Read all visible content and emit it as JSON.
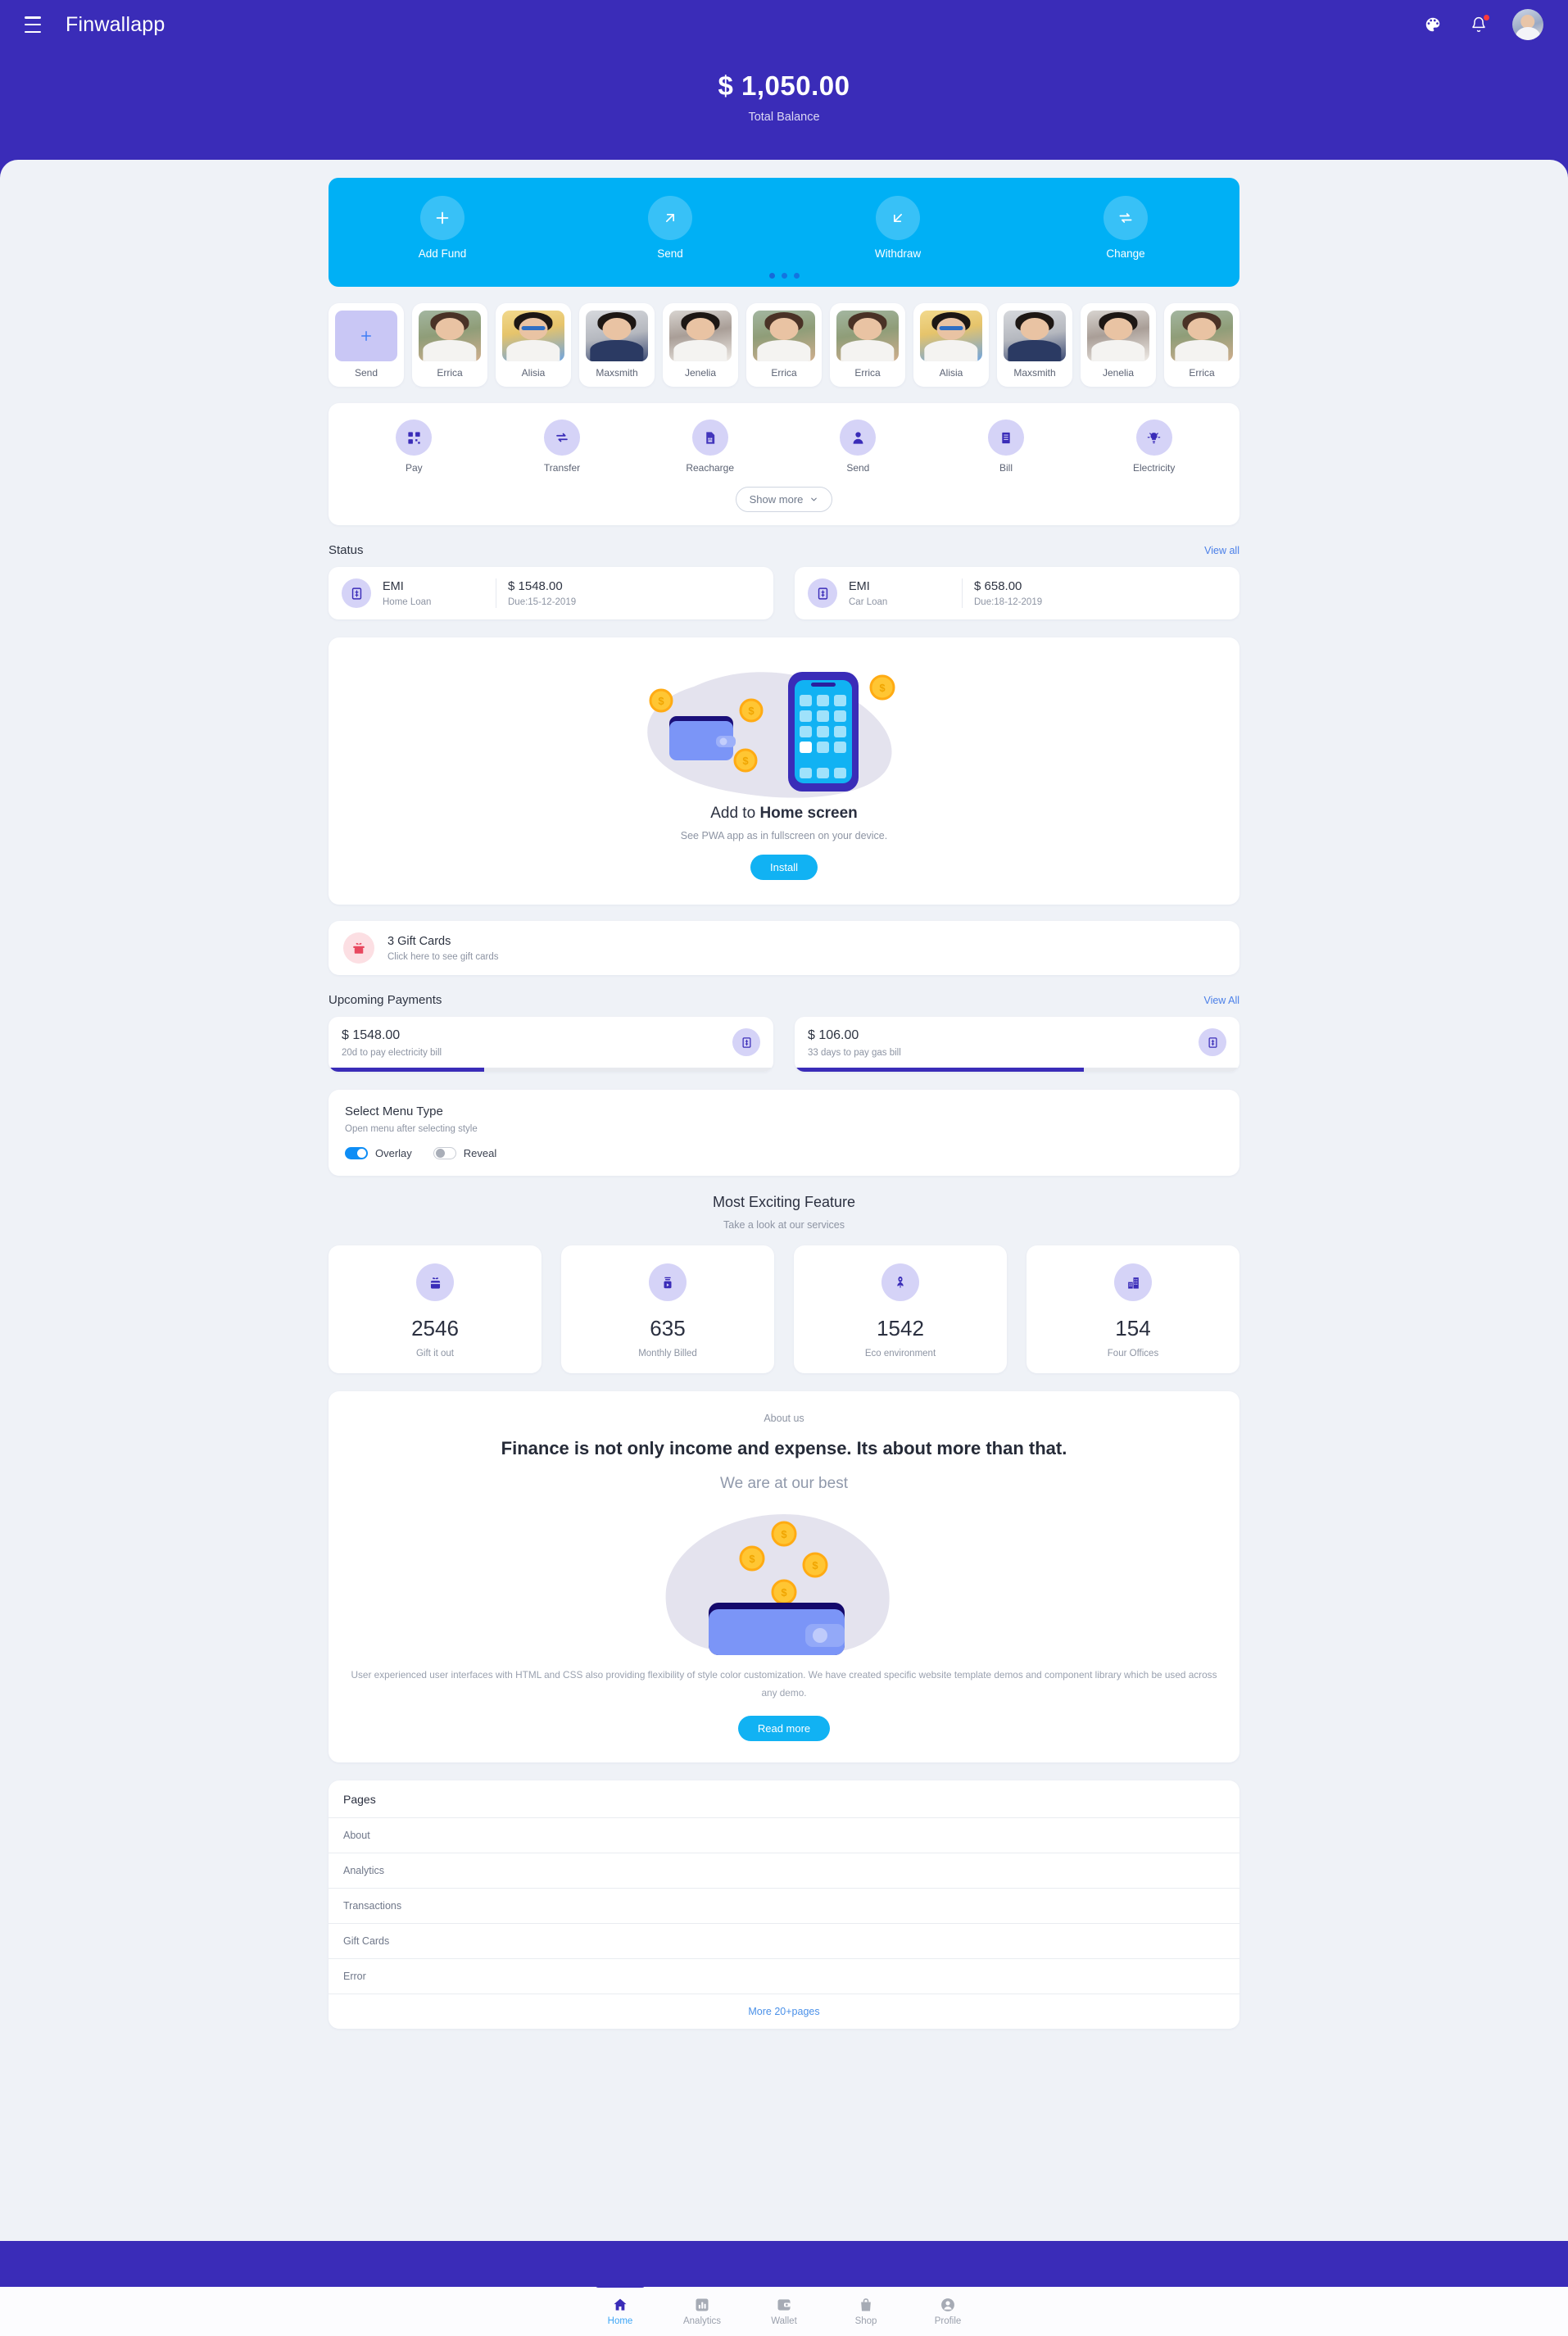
{
  "header": {
    "brand": "Finwallapp",
    "menu_icon": "hamburger-icon",
    "theme_icon": "palette-icon",
    "notification_icon": "bell-icon",
    "avatar": "user-avatar"
  },
  "hero": {
    "amount": "$ 1,050.00",
    "label": "Total Balance"
  },
  "actions": {
    "items": [
      {
        "label": "Add Fund",
        "icon": "plus-icon"
      },
      {
        "label": "Send",
        "icon": "arrow-up-right-icon"
      },
      {
        "label": "Withdraw",
        "icon": "arrow-down-left-icon"
      },
      {
        "label": "Change",
        "icon": "exchange-icon"
      }
    ],
    "dots": 3,
    "active_dot": 0
  },
  "contacts": {
    "add_label": "Send",
    "items": [
      {
        "name": "Errica",
        "style": "p-a"
      },
      {
        "name": "Alisia",
        "style": "p-b"
      },
      {
        "name": "Maxsmith",
        "style": "p-c"
      },
      {
        "name": "Jenelia",
        "style": "p-d"
      },
      {
        "name": "Errica",
        "style": "p-a"
      },
      {
        "name": "Errica",
        "style": "p-a"
      },
      {
        "name": "Alisia",
        "style": "p-b"
      },
      {
        "name": "Maxsmith",
        "style": "p-c"
      },
      {
        "name": "Jenelia",
        "style": "p-d"
      },
      {
        "name": "Errica",
        "style": "p-a"
      }
    ]
  },
  "services": {
    "items": [
      {
        "label": "Pay",
        "icon": "qr-code-icon"
      },
      {
        "label": "Transfer",
        "icon": "transfer-icon"
      },
      {
        "label": "Reacharge",
        "icon": "sim-card-icon"
      },
      {
        "label": "Send",
        "icon": "person-icon"
      },
      {
        "label": "Bill",
        "icon": "receipt-icon"
      },
      {
        "label": "Electricity",
        "icon": "bulb-icon"
      }
    ],
    "show_more_label": "Show more",
    "chevron_icon": "chevron-down-icon"
  },
  "status": {
    "title": "Status",
    "view_all": "View all",
    "items": [
      {
        "title": "EMI",
        "sub": "Home Loan",
        "amount": "$ 1548.00",
        "due": "Due:15-12-2019",
        "icon": "money-bill-icon"
      },
      {
        "title": "EMI",
        "sub": "Car Loan",
        "amount": "$ 658.00",
        "due": "Due:18-12-2019",
        "icon": "money-bill-icon"
      }
    ]
  },
  "pwa": {
    "title_plain": "Add to ",
    "title_bold": "Home screen",
    "subtitle": "See PWA app as in fullscreen on your device.",
    "button": "Install",
    "illustration": "wallet-phone-coins-illustration"
  },
  "gift": {
    "title": "3 Gift Cards",
    "subtitle": "Click here to see gift cards",
    "icon": "gift-icon"
  },
  "upcoming": {
    "title": "Upcoming Payments",
    "view_all": "View All",
    "items": [
      {
        "amount": "$ 1548.00",
        "sub": "20d to pay electricity bill",
        "progress": 35,
        "icon": "money-bill-icon"
      },
      {
        "amount": "$ 106.00",
        "sub": "33 days to pay gas bill",
        "progress": 65,
        "icon": "money-bill-icon"
      }
    ]
  },
  "menu_type": {
    "title": "Select Menu Type",
    "subtitle": "Open menu after selecting style",
    "options": [
      {
        "label": "Overlay",
        "state": "on"
      },
      {
        "label": "Reveal",
        "state": "off"
      }
    ]
  },
  "features": {
    "title": "Most Exciting Feature",
    "subtitle": "Take a look at our services",
    "stats": [
      {
        "value": "2546",
        "label": "Gift it out",
        "icon": "gift-bag-icon"
      },
      {
        "value": "635",
        "label": "Monthly Billed",
        "icon": "billing-icon"
      },
      {
        "value": "1542",
        "label": "Eco environment",
        "icon": "eco-leaf-icon"
      },
      {
        "value": "154",
        "label": "Four Offices",
        "icon": "building-icon"
      }
    ]
  },
  "about": {
    "kicker": "About us",
    "heading": "Finance is not only income and expense. Its about more than that.",
    "subheading": "We are at our best",
    "paragraph": "User experienced user interfaces with HTML and CSS also providing flexibility of style color customization. We have created specific website template demos and component library which be used across any demo.",
    "button": "Read more",
    "illustration": "wallet-coins-illustration"
  },
  "pages": {
    "title": "Pages",
    "items": [
      "About",
      "Analytics",
      "Transactions",
      "Gift Cards",
      "Error"
    ],
    "footer": "More 20+pages"
  },
  "bottom_nav": {
    "items": [
      {
        "label": "Home",
        "icon": "home-icon",
        "active": true
      },
      {
        "label": "Analytics",
        "icon": "bar-chart-icon",
        "active": false
      },
      {
        "label": "Wallet",
        "icon": "wallet-icon",
        "active": false
      },
      {
        "label": "Shop",
        "icon": "shopping-bag-icon",
        "active": false
      },
      {
        "label": "Profile",
        "icon": "person-circle-icon",
        "active": false
      }
    ]
  },
  "colors": {
    "brand_purple": "#3a2cb8",
    "accent_blue": "#00b0f5",
    "sheet_bg": "#eff2f7",
    "icon_lilac": "#d5d3f7",
    "link_blue": "#4a7fe8",
    "gift_pink": "#fcdfe3"
  }
}
